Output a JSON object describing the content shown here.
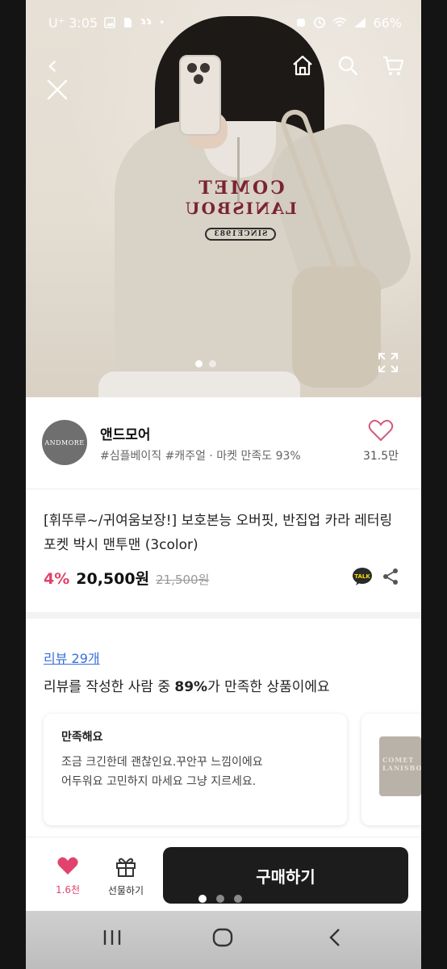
{
  "status_bar": {
    "carrier_time": "U⁺ 3:05",
    "left_icons": [
      "image-icon",
      "sim-icon",
      "quote-icon",
      "dot-icon"
    ],
    "right_icons": [
      "alarm-icon",
      "clock-icon",
      "wifi-icon",
      "signal-icon"
    ],
    "battery": "66%"
  },
  "hero": {
    "print_line1": "COMET",
    "print_line2": "LANISBOU",
    "print_badge": "SINCE1983",
    "image_dots": 2,
    "active_dot": 0
  },
  "store": {
    "avatar_text": "ANDMORE",
    "name": "앤드모어",
    "tags": "#심플베이직 #캐주얼 · 마켓 만족도 93%",
    "like_count": "31.5만"
  },
  "product": {
    "title": "[휘뚜루~/귀여움보장!] 보호본능 오버핏, 반집업 카라 레터링 포켓 박시 맨투맨 (3color)",
    "discount": "4%",
    "price": "20,500원",
    "original_price": "21,500원",
    "talk_label": "TALK"
  },
  "reviews": {
    "link": "리뷰 29개",
    "summary_prefix": "리뷰를 작성한 사람 중 ",
    "summary_percent": "89%",
    "summary_suffix": "가 만족한 상품이에요",
    "card": {
      "title": "만족해요",
      "body_line1": "조금 크긴한데 괜찮인요.꾸안꾸 느낌이에요",
      "body_line2": "어두워요 고민하지 마세요 그냥 지르세요."
    },
    "thumb_text": "COMET LANISBOU"
  },
  "bottom_bar": {
    "heart_count": "1.6천",
    "gift_label": "선물하기",
    "buy_label": "구매하기",
    "pager_dots": 3,
    "pager_active": 0
  },
  "colors": {
    "accent_pink": "#e0436b",
    "link_blue": "#3a6fd8",
    "buy_button": "#1c1c1c"
  }
}
